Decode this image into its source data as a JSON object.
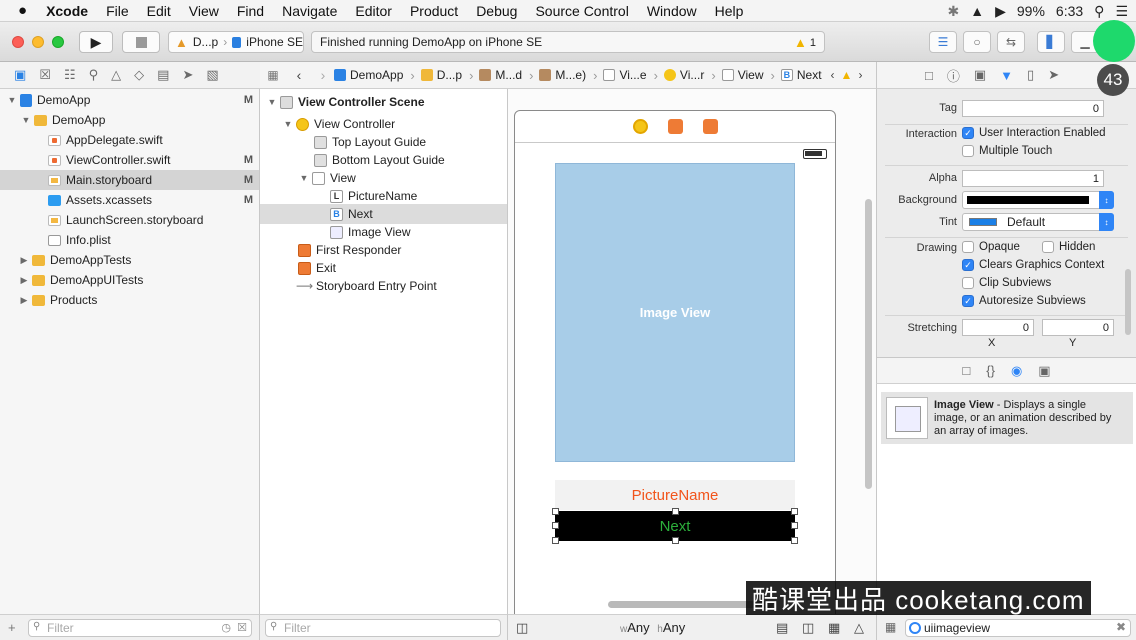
{
  "menubar": {
    "apple": "",
    "app": "Xcode",
    "items": [
      "File",
      "Edit",
      "View",
      "Find",
      "Navigate",
      "Editor",
      "Product",
      "Debug",
      "Source Control",
      "Window",
      "Help"
    ],
    "battery": "99%",
    "time": "6:33"
  },
  "toolbar": {
    "scheme_target": "D...p",
    "scheme_device": "iPhone SE",
    "status": "Finished running DemoApp on iPhone SE",
    "warning_count": "1"
  },
  "navigator": {
    "items": [
      {
        "label": "DemoApp",
        "badge": "M"
      },
      {
        "label": "DemoApp",
        "badge": ""
      },
      {
        "label": "AppDelegate.swift",
        "badge": ""
      },
      {
        "label": "ViewController.swift",
        "badge": "M"
      },
      {
        "label": "Main.storyboard",
        "badge": "M"
      },
      {
        "label": "Assets.xcassets",
        "badge": "M"
      },
      {
        "label": "LaunchScreen.storyboard",
        "badge": ""
      },
      {
        "label": "Info.plist",
        "badge": ""
      },
      {
        "label": "DemoAppTests",
        "badge": ""
      },
      {
        "label": "DemoAppUITests",
        "badge": ""
      },
      {
        "label": "Products",
        "badge": ""
      }
    ],
    "filter_placeholder": "Filter"
  },
  "jumpbar": {
    "items": [
      "DemoApp",
      "D...p",
      "M...d",
      "M...e)",
      "Vi...e",
      "Vi...r",
      "View",
      "Next"
    ]
  },
  "outline": {
    "items": [
      {
        "label": "View Controller Scene",
        "icon": "S"
      },
      {
        "label": "View Controller",
        "icon": ""
      },
      {
        "label": "Top Layout Guide",
        "icon": ""
      },
      {
        "label": "Bottom Layout Guide",
        "icon": ""
      },
      {
        "label": "View",
        "icon": ""
      },
      {
        "label": "PictureName",
        "icon": "L"
      },
      {
        "label": "Next",
        "icon": "B"
      },
      {
        "label": "Image View",
        "icon": ""
      },
      {
        "label": "First Responder",
        "icon": ""
      },
      {
        "label": "Exit",
        "icon": ""
      },
      {
        "label": "Storyboard Entry Point",
        "icon": ""
      }
    ],
    "filter_placeholder": "Filter"
  },
  "canvas": {
    "image_view_label": "Image View",
    "picture_name": "PictureName",
    "next_label": "Next",
    "size_w": "Any",
    "size_h": "Any",
    "w_prefix": "w",
    "h_prefix": "h"
  },
  "inspector": {
    "tag_label": "Tag",
    "tag_value": "0",
    "interaction_label": "Interaction",
    "user_interaction": "User Interaction Enabled",
    "multiple_touch": "Multiple Touch",
    "alpha_label": "Alpha",
    "alpha_value": "1",
    "background_label": "Background",
    "tint_label": "Tint",
    "tint_value": "Default",
    "drawing_label": "Drawing",
    "opaque": "Opaque",
    "hidden": "Hidden",
    "clears_graphics": "Clears Graphics Context",
    "clip_subviews": "Clip Subviews",
    "autoresize": "Autoresize Subviews",
    "stretching_label": "Stretching",
    "stretch_x": "0",
    "stretch_y": "0",
    "x_label": "X",
    "y_label": "Y",
    "tint_color": "#1a7fe6"
  },
  "library": {
    "title": "Image View",
    "desc_1": " - Displays a single",
    "desc_2": "image, or an animation described by",
    "desc_3": "an array of images.",
    "filter_value": "uiimageview"
  },
  "overlay": {
    "watermark": "酷课堂出品 cooketang.com",
    "step_badge": "43"
  },
  "colors": {
    "accent": "#2f85f6",
    "image_view_bg": "#a8cde8",
    "picture_name_text": "#f2541b",
    "next_text": "#2cae3b",
    "highlight": "#1ed96c"
  }
}
